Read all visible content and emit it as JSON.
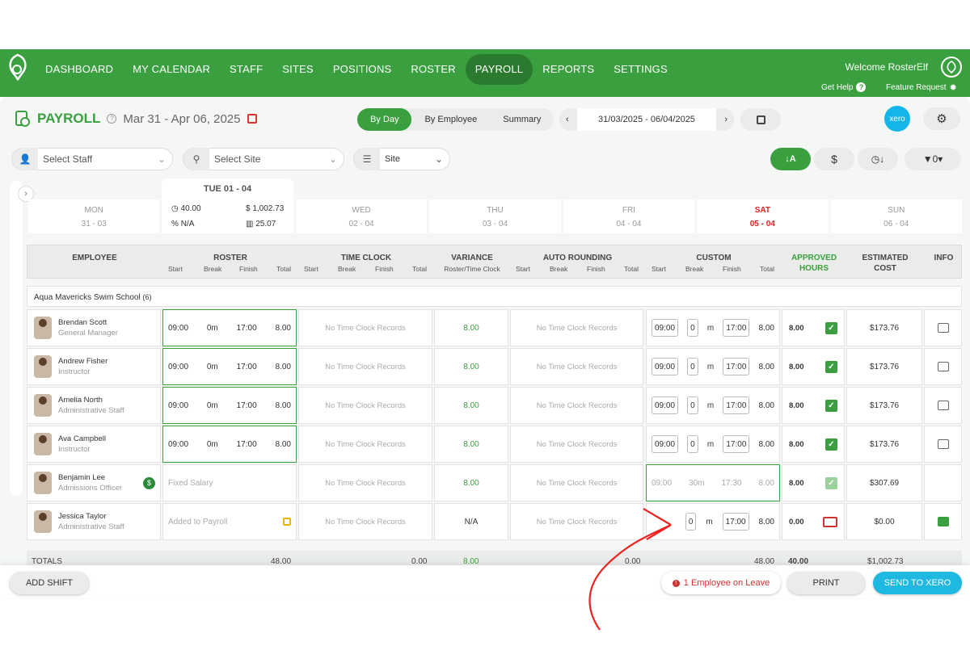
{
  "nav": {
    "items": [
      "DASHBOARD",
      "MY CALENDAR",
      "STAFF",
      "SITES",
      "POSITIONS",
      "ROSTER",
      "PAYROLL",
      "REPORTS",
      "SETTINGS"
    ],
    "active": "PAYROLL",
    "welcome": "Welcome RosterElf",
    "help": "Get Help",
    "feature": "Feature Request"
  },
  "header": {
    "title": "PAYROLL",
    "range": "Mar 31 - Apr 06, 2025",
    "views": [
      "By Day",
      "By Employee",
      "Summary"
    ],
    "dates": "31/03/2025 - 06/04/2025",
    "xero": "xero"
  },
  "filters": {
    "staff": "Select Staff",
    "site": "Select Site",
    "group": "Site"
  },
  "days": [
    {
      "d": "MON",
      "n": "31 - 03"
    },
    {
      "d": "TUE 01 - 04",
      "n": ""
    },
    {
      "d": "WED",
      "n": "02 - 04"
    },
    {
      "d": "THU",
      "n": "03 - 04"
    },
    {
      "d": "FRI",
      "n": "04 - 04"
    },
    {
      "d": "SAT",
      "n": "05 - 04"
    },
    {
      "d": "SUN",
      "n": "06 - 04"
    }
  ],
  "tue": {
    "hours": "40.00",
    "cost": "$ 1,002.73",
    "pct": "N/A",
    "avg": "25.07"
  },
  "columns": {
    "employee": "EMPLOYEE",
    "roster": "ROSTER",
    "timeclock": "TIME CLOCK",
    "variance": "VARIANCE",
    "variance_sub": "Roster/Time Clock",
    "autorounding": "AUTO ROUNDING",
    "custom": "CUSTOM",
    "approved1": "APPROVED",
    "approved2": "HOURS",
    "est1": "ESTIMATED",
    "est2": "COST",
    "info": "INFO",
    "start": "Start",
    "break": "Break",
    "finish": "Finish",
    "total": "Total"
  },
  "group": {
    "name": "Aqua Mavericks Swim School",
    "count": "(6)"
  },
  "rows": [
    {
      "name": "Brendan Scott",
      "role": "General Manager",
      "rs": "09:00",
      "rb": "0m",
      "rf": "17:00",
      "rt": "8.00",
      "tc": "No Time Clock Records",
      "var": "8.00",
      "ar": "No Time Clock Records",
      "cs": "09:00",
      "cb": "0",
      "cf": "17:00",
      "ct": "8.00",
      "ap": "8.00",
      "est": "$173.76"
    },
    {
      "name": "Andrew Fisher",
      "role": "Instructor",
      "rs": "09:00",
      "rb": "0m",
      "rf": "17:00",
      "rt": "8.00",
      "tc": "No Time Clock Records",
      "var": "8.00",
      "ar": "No Time Clock Records",
      "cs": "09:00",
      "cb": "0",
      "cf": "17:00",
      "ct": "8.00",
      "ap": "8.00",
      "est": "$173.76"
    },
    {
      "name": "Amelia North",
      "role": "Administrative Staff",
      "rs": "09:00",
      "rb": "0m",
      "rf": "17:00",
      "rt": "8.00",
      "tc": "No Time Clock Records",
      "var": "8.00",
      "ar": "No Time Clock Records",
      "cs": "09:00",
      "cb": "0",
      "cf": "17:00",
      "ct": "8.00",
      "ap": "8.00",
      "est": "$173.76"
    },
    {
      "name": "Ava Campbell",
      "role": "Instructor",
      "rs": "09:00",
      "rb": "0m",
      "rf": "17:00",
      "rt": "8.00",
      "tc": "No Time Clock Records",
      "var": "8.00",
      "ar": "No Time Clock Records",
      "cs": "09:00",
      "cb": "0",
      "cf": "17:00",
      "ct": "8.00",
      "ap": "8.00",
      "est": "$173.76"
    },
    {
      "name": "Benjamin Lee",
      "role": "Admissions Officer",
      "roster_note": "Fixed Salary",
      "tc": "No Time Clock Records",
      "var": "8.00",
      "ar": "No Time Clock Records",
      "cs": "09:00",
      "cb": "30m",
      "cf": "17:30",
      "ct": "8.00",
      "ap": "8.00",
      "est": "$307.69"
    },
    {
      "name": "Jessica Taylor",
      "role": "Administrative Staff",
      "roster_note": "Added to Payroll",
      "tc": "No Time Clock Records",
      "var": "N/A",
      "ar": "No Time Clock Records",
      "cb": "0",
      "cf": "17:00",
      "ct": "8.00",
      "ap": "0.00",
      "est": "$0.00"
    }
  ],
  "totals": {
    "label": "TOTALS",
    "roster": "48.00",
    "tc": "0.00",
    "var": "8.00",
    "ar": "0.00",
    "custom": "48.00",
    "ap": "40.00",
    "est": "$1,002.73"
  },
  "m": "m",
  "bottom": {
    "add": "ADD SHIFT",
    "leave": "1 Employee on Leave",
    "print": "PRINT",
    "send": "SEND TO XERO"
  }
}
